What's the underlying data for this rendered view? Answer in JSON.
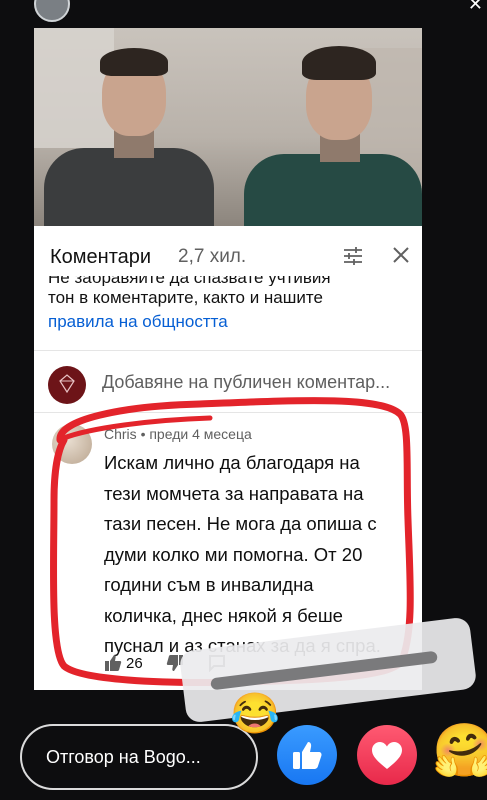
{
  "story": {
    "close_icon": "close-icon"
  },
  "video": {
    "thumbnail": "two-men-photo"
  },
  "comments_panel": {
    "title": "Коментари",
    "count": "2,7 хил.",
    "guidelines_cut": "Не забравяйте да спазвате учтивия",
    "guidelines_line": "тон в коментарите, както и нашите",
    "guidelines_link": "правила на общността",
    "link_color": "#065fd4"
  },
  "add_comment": {
    "placeholder": "Добавяне на публичен коментар..."
  },
  "comment": {
    "author": "Chris",
    "time": "• преди 4 месеца",
    "lines": [
      "Искам лично да благодаря на",
      "тези момчета за направата на",
      "тази песен. Не мога да опиша с",
      "думи колко ми помогна. От 20",
      "години съм в инвалидна",
      "количка, днес някой я беше",
      "пуснал и аз станах за да я спра."
    ],
    "likes": "26"
  },
  "reply_bar": {
    "placeholder": "Отговор на Bogo..."
  },
  "reactions": {
    "laugh_emoji": "😂",
    "hug_emoji": "🤗",
    "like_color": "#1877f2",
    "love_color": "#e8294a"
  },
  "annotation_color": "#e3242b"
}
